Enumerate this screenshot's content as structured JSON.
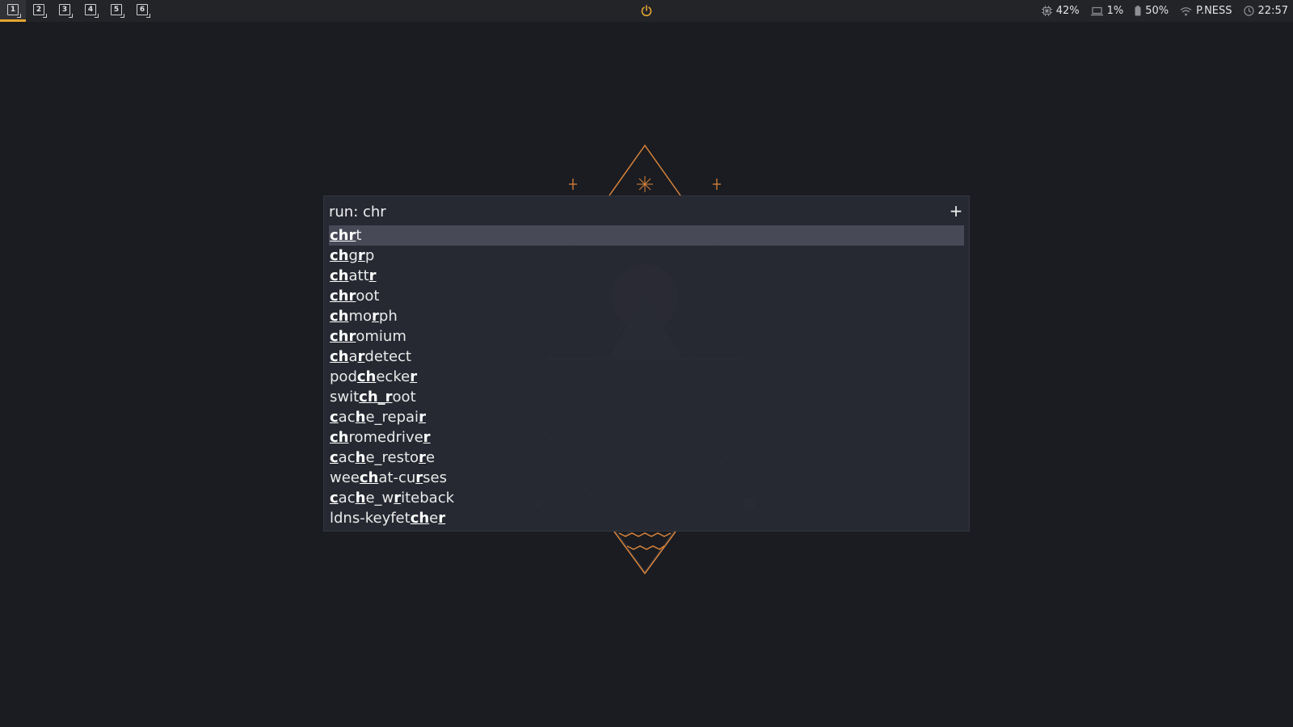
{
  "topbar": {
    "workspaces": [
      "1",
      "2",
      "3",
      "4",
      "5",
      "6"
    ],
    "active_workspace": "1",
    "status": {
      "cpu": "42%",
      "memory": "1%",
      "battery": "50%",
      "network": "P.NESS",
      "clock": "22:57"
    },
    "accent_color": "#e6a531"
  },
  "launcher": {
    "prompt": "run: chr",
    "add_label": "+",
    "selected_index": 0,
    "accent_color": "#b98fd8",
    "results": [
      [
        [
          "chr",
          true
        ],
        [
          "t",
          false
        ]
      ],
      [
        [
          "ch",
          true
        ],
        [
          "g",
          false
        ],
        [
          "r",
          true
        ],
        [
          "p",
          false
        ]
      ],
      [
        [
          "ch",
          true
        ],
        [
          "att",
          false
        ],
        [
          "r",
          true
        ]
      ],
      [
        [
          "chr",
          true
        ],
        [
          "oot",
          false
        ]
      ],
      [
        [
          "ch",
          true
        ],
        [
          "mo",
          false
        ],
        [
          "r",
          true
        ],
        [
          "ph",
          false
        ]
      ],
      [
        [
          "chr",
          true
        ],
        [
          "omium",
          false
        ]
      ],
      [
        [
          "ch",
          true
        ],
        [
          "a",
          false
        ],
        [
          "r",
          true
        ],
        [
          "detect",
          false
        ]
      ],
      [
        [
          "pod",
          false
        ],
        [
          "ch",
          true
        ],
        [
          "ecke",
          false
        ],
        [
          "r",
          true
        ]
      ],
      [
        [
          "swit",
          false
        ],
        [
          "ch_r",
          true
        ],
        [
          "oot",
          false
        ]
      ],
      [
        [
          "c",
          true
        ],
        [
          "ac",
          false
        ],
        [
          "h",
          true
        ],
        [
          "e_repai",
          false
        ],
        [
          "r",
          true
        ]
      ],
      [
        [
          "ch",
          true
        ],
        [
          "romedrive",
          false
        ],
        [
          "r",
          true
        ]
      ],
      [
        [
          "c",
          true
        ],
        [
          "ac",
          false
        ],
        [
          "h",
          true
        ],
        [
          "e_resto",
          false
        ],
        [
          "r",
          true
        ],
        [
          "e",
          false
        ]
      ],
      [
        [
          "wee",
          false
        ],
        [
          "ch",
          true
        ],
        [
          "at-cu",
          false
        ],
        [
          "r",
          true
        ],
        [
          "ses",
          false
        ]
      ],
      [
        [
          "c",
          true
        ],
        [
          "ac",
          false
        ],
        [
          "h",
          true
        ],
        [
          "e_w",
          false
        ],
        [
          "r",
          true
        ],
        [
          "iteback",
          false
        ]
      ],
      [
        [
          "ldns-keyfet",
          false
        ],
        [
          "ch",
          true
        ],
        [
          "e",
          false
        ],
        [
          "r",
          true
        ]
      ]
    ]
  },
  "wallpaper": {
    "line_color": "#d9833a",
    "faint_color": "#3a3a40"
  }
}
